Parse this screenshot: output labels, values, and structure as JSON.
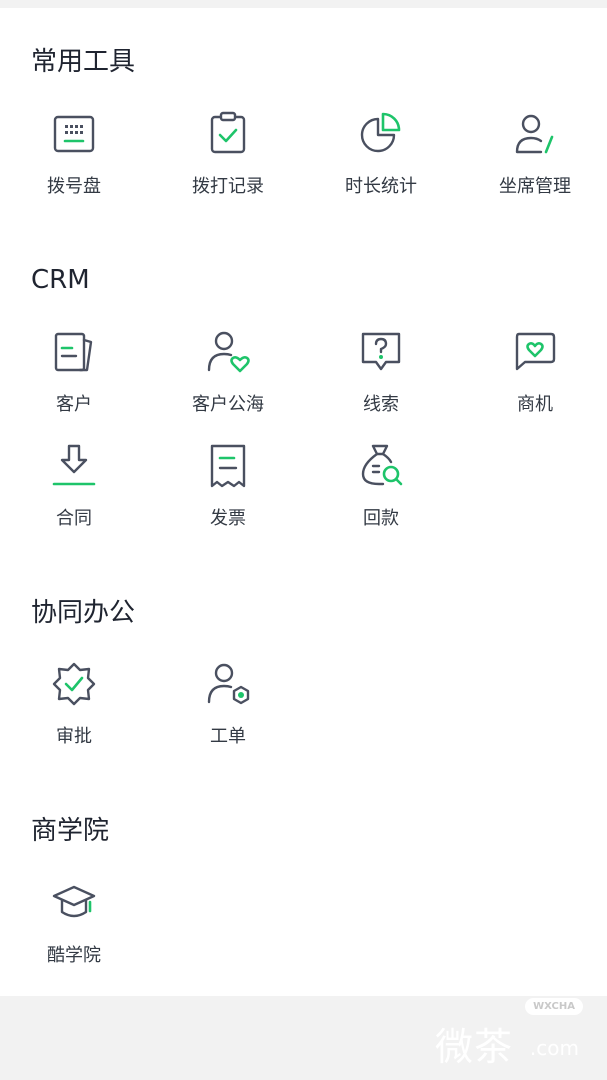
{
  "sections": {
    "tools": {
      "title": "常用工具",
      "items": [
        {
          "label": "拨号盘",
          "icon": "keyboard-icon"
        },
        {
          "label": "拨打记录",
          "icon": "clipboard-check-icon"
        },
        {
          "label": "时长统计",
          "icon": "pie-chart-icon"
        },
        {
          "label": "坐席管理",
          "icon": "agent-icon"
        }
      ]
    },
    "crm": {
      "title": "CRM",
      "items": [
        {
          "label": "客户",
          "icon": "customer-doc-icon"
        },
        {
          "label": "客户公海",
          "icon": "user-heart-icon"
        },
        {
          "label": "线索",
          "icon": "question-bubble-icon"
        },
        {
          "label": "商机",
          "icon": "heart-bubble-icon"
        },
        {
          "label": "合同",
          "icon": "download-icon"
        },
        {
          "label": "发票",
          "icon": "receipt-icon"
        },
        {
          "label": "回款",
          "icon": "money-bag-search-icon"
        }
      ]
    },
    "office": {
      "title": "协同办公",
      "items": [
        {
          "label": "审批",
          "icon": "badge-check-icon"
        },
        {
          "label": "工单",
          "icon": "user-gear-icon"
        }
      ]
    },
    "academy": {
      "title": "商学院",
      "items": [
        {
          "label": "酷学院",
          "icon": "graduation-cap-icon"
        }
      ]
    }
  },
  "watermark": {
    "main": "微茶",
    "badge": "WXCHA",
    "sub": ".com"
  },
  "colors": {
    "accent": "#1ec46a",
    "icon_ink": "#4a5060",
    "background": "#f2f2f2",
    "card": "#ffffff"
  }
}
